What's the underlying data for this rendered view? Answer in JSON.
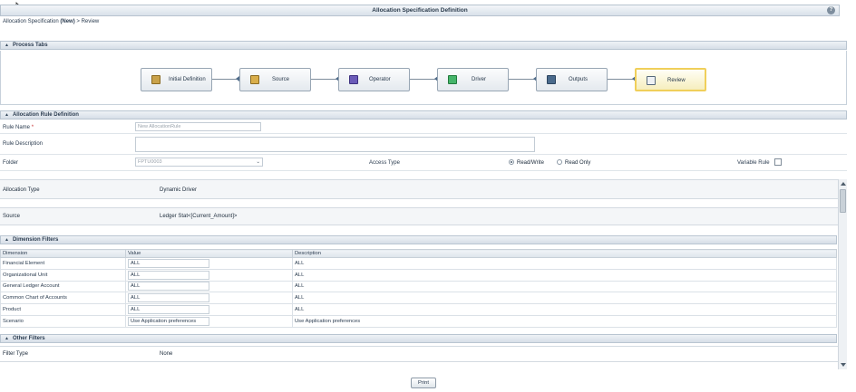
{
  "window": {
    "title": "Allocation Specification Definition"
  },
  "breadcrumb": {
    "root": "Allocation Specification",
    "mode": "(New)",
    "separator": ">",
    "current": "Review"
  },
  "process_tabs": {
    "header": "Process Tabs",
    "tabs": [
      {
        "label": "Initial Definition",
        "icon": "definition-icon"
      },
      {
        "label": "Source",
        "icon": "source-icon"
      },
      {
        "label": "Operator",
        "icon": "operator-icon"
      },
      {
        "label": "Driver",
        "icon": "driver-icon"
      },
      {
        "label": "Outputs",
        "icon": "outputs-icon"
      },
      {
        "label": "Review",
        "icon": "review-icon",
        "active": true
      }
    ]
  },
  "rule_definition": {
    "header": "Allocation Rule Definition",
    "rule_name_label": "Rule Name",
    "rule_name_required": "*",
    "rule_name_placeholder": "New AllocationRule",
    "rule_description_label": "Rule Description",
    "folder_label": "Folder",
    "folder_value": "FPTU0003",
    "access_type_label": "Access Type",
    "access_read_write": "Read/Write",
    "access_read_only": "Read Only",
    "access_selected": "Read/Write",
    "variable_rule_label": "Variable Rule"
  },
  "summary": {
    "allocation_type_label": "Allocation Type",
    "allocation_type_value": "Dynamic Driver",
    "source_label": "Source",
    "source_value": "Ledger Stat<[Current_Amount]>"
  },
  "dimension_filters": {
    "header": "Dimension Filters",
    "columns": [
      "Dimension",
      "Value",
      "Description"
    ],
    "rows": [
      {
        "dimension": "Financial Element",
        "value": "ALL",
        "description": "ALL"
      },
      {
        "dimension": "Organizational Unit",
        "value": "ALL",
        "description": "ALL"
      },
      {
        "dimension": "General Ledger Account",
        "value": "ALL",
        "description": "ALL"
      },
      {
        "dimension": "Common Chart of Accounts",
        "value": "ALL",
        "description": "ALL"
      },
      {
        "dimension": "Product",
        "value": "ALL",
        "description": "ALL"
      },
      {
        "dimension": "Scenario",
        "value": "Use Application preferences",
        "description": "Use Application preferences"
      }
    ]
  },
  "other_filters": {
    "header": "Other Filters",
    "filter_type_label": "Filter Type",
    "filter_type_value": "None"
  },
  "footer": {
    "print_label": "Print"
  },
  "colors": {
    "active_tab_border": "#f0cf5a",
    "header_bg": "#d6dee7",
    "required": "#c62c2c"
  }
}
